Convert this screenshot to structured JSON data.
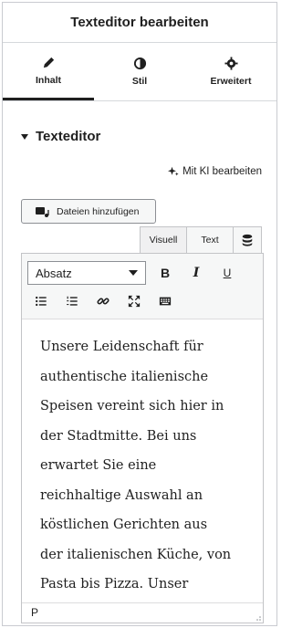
{
  "header": {
    "title": "Texteditor bearbeiten"
  },
  "tabs": [
    {
      "label": "Inhalt",
      "icon": "pencil-icon",
      "active": true
    },
    {
      "label": "Stil",
      "icon": "contrast-icon",
      "active": false
    },
    {
      "label": "Erweitert",
      "icon": "gear-icon",
      "active": false
    }
  ],
  "section": {
    "title": "Texteditor"
  },
  "ai": {
    "label": "Mit KI bearbeiten",
    "icon": "sparkle-icon"
  },
  "media": {
    "label": "Dateien hinzufügen",
    "icon": "media-icon"
  },
  "editor_tabs": {
    "visual": "Visuell",
    "text": "Text",
    "extra_icon": "database-icon"
  },
  "toolbar": {
    "format_value": "Absatz",
    "bold": "B",
    "italic": "I",
    "underline": "U",
    "icons": [
      "bullet-list-icon",
      "numbered-list-icon",
      "link-icon",
      "fullscreen-icon",
      "keyboard-icon"
    ]
  },
  "content": {
    "lines": [
      "Unsere Leidenschaft für",
      "authentische italienische",
      "Speisen vereint sich hier in",
      "der Stadtmitte. Bei uns",
      "erwartet Sie eine",
      "reichhaltige Auswahl an",
      "köstlichen Gerichten aus",
      "der italienischen Küche, von",
      "Pasta bis Pizza. Unser"
    ]
  },
  "status": {
    "path": "P"
  }
}
